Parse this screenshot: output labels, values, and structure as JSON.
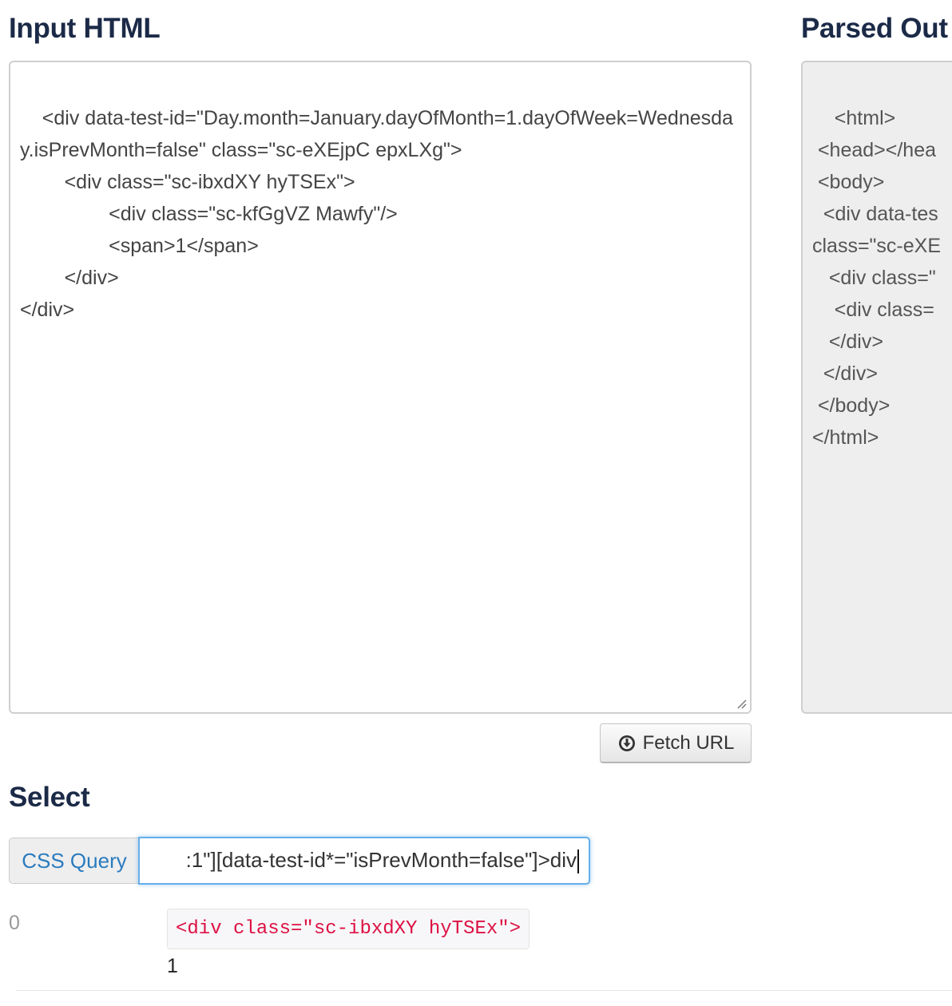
{
  "input_section": {
    "title": "Input HTML",
    "content": "<div data-test-id=\"Day.month=January.dayOfMonth=1.dayOfWeek=Wednesday.isPrevMonth=false\" class=\"sc-eXEjpC epxLXg\">\n\t<div class=\"sc-ibxdXY hyTSEx\">\n\t\t<div class=\"sc-kfGgVZ Mawfy\"/>\n\t\t<span>1</span>\n\t</div>\n</div>"
  },
  "output_section": {
    "title": "Parsed Out",
    "content": "<html>\n <head></hea\n <body>\n  <div data-tes\nclass=\"sc-eXE\n   <div class=\"\n    <div class=\n   </div>\n  </div>\n </body>\n</html>"
  },
  "fetch_button": {
    "label": "Fetch URL",
    "icon": "download-circle-icon"
  },
  "select_section": {
    "title": "Select",
    "query_label": "CSS Query",
    "query_value": ":1\"][data-test-id*=\"isPrevMonth=false\"]>div"
  },
  "results": [
    {
      "index": "0",
      "code": "<div class=\"sc-ibxdXY hyTSEx\">",
      "text": "1"
    }
  ],
  "colors": {
    "heading": "#1b2a47",
    "accent_link": "#2a7bbf",
    "focus_border": "#66afe9",
    "code_text": "#dd1144"
  }
}
